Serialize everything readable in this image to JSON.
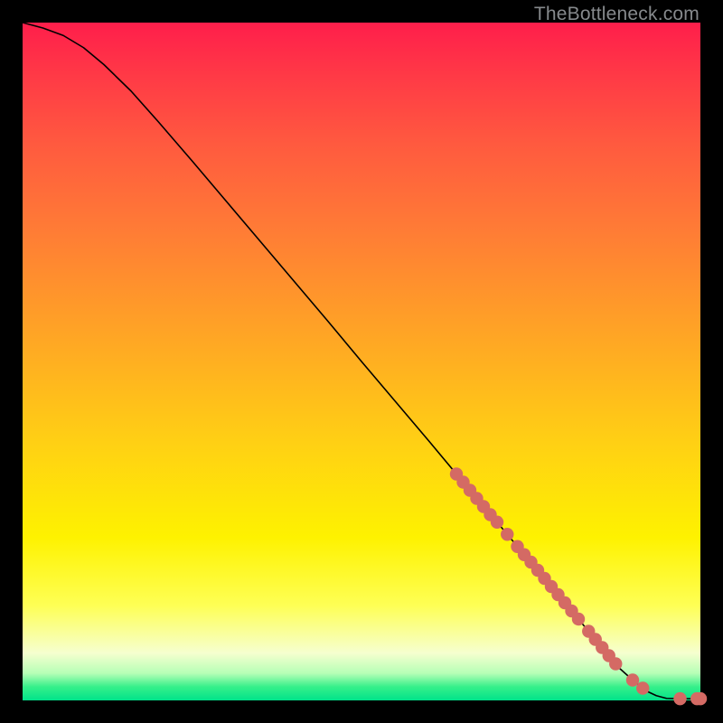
{
  "attribution": "TheBottleneck.com",
  "colors": {
    "background": "#000000",
    "gradient_top": "#ff1e4b",
    "gradient_mid": "#fef200",
    "gradient_bottom": "#00e28a",
    "curve": "#000000",
    "marker_fill": "#d46a64",
    "marker_stroke": "#b65550",
    "attribution_text": "#86898c"
  },
  "chart_data": {
    "type": "line",
    "title": "",
    "xlabel": "",
    "ylabel": "",
    "xlim": [
      0,
      100
    ],
    "ylim": [
      0,
      100
    ],
    "grid": false,
    "legend": false,
    "series": [
      {
        "name": "curve",
        "x": [
          0,
          3,
          6,
          9,
          12,
          16,
          20,
          25,
          30,
          35,
          40,
          45,
          50,
          55,
          60,
          65,
          70,
          72,
          75,
          78,
          80,
          82,
          84,
          86,
          88,
          90,
          92,
          93.5,
          95,
          97,
          100
        ],
        "y": [
          100,
          99.2,
          98.1,
          96.3,
          93.8,
          89.9,
          85.4,
          79.6,
          73.7,
          67.8,
          61.9,
          56.0,
          50.0,
          44.1,
          38.2,
          32.2,
          26.3,
          23.9,
          20.4,
          16.8,
          14.4,
          12.0,
          9.6,
          7.2,
          4.8,
          3.0,
          1.4,
          0.7,
          0.3,
          0.25,
          0.25
        ]
      }
    ],
    "markers": [
      {
        "x": 64.0,
        "y": 33.4,
        "r": 1.0
      },
      {
        "x": 65.0,
        "y": 32.2,
        "r": 1.0
      },
      {
        "x": 66.0,
        "y": 31.0,
        "r": 1.0
      },
      {
        "x": 67.0,
        "y": 29.8,
        "r": 1.0
      },
      {
        "x": 68.0,
        "y": 28.6,
        "r": 1.0
      },
      {
        "x": 69.0,
        "y": 27.4,
        "r": 1.0
      },
      {
        "x": 70.0,
        "y": 26.3,
        "r": 1.0
      },
      {
        "x": 71.5,
        "y": 24.5,
        "r": 1.0
      },
      {
        "x": 73.0,
        "y": 22.7,
        "r": 1.0
      },
      {
        "x": 74.0,
        "y": 21.5,
        "r": 1.0
      },
      {
        "x": 75.0,
        "y": 20.4,
        "r": 1.0
      },
      {
        "x": 76.0,
        "y": 19.2,
        "r": 1.0
      },
      {
        "x": 77.0,
        "y": 18.0,
        "r": 1.0
      },
      {
        "x": 78.0,
        "y": 16.8,
        "r": 1.0
      },
      {
        "x": 79.0,
        "y": 15.6,
        "r": 1.0
      },
      {
        "x": 80.0,
        "y": 14.4,
        "r": 1.0
      },
      {
        "x": 81.0,
        "y": 13.2,
        "r": 1.0
      },
      {
        "x": 82.0,
        "y": 12.0,
        "r": 1.0
      },
      {
        "x": 83.5,
        "y": 10.2,
        "r": 1.0
      },
      {
        "x": 84.5,
        "y": 9.0,
        "r": 1.0
      },
      {
        "x": 85.5,
        "y": 7.8,
        "r": 1.0
      },
      {
        "x": 86.5,
        "y": 6.6,
        "r": 1.0
      },
      {
        "x": 87.5,
        "y": 5.4,
        "r": 1.0
      },
      {
        "x": 90.0,
        "y": 3.0,
        "r": 1.0
      },
      {
        "x": 91.5,
        "y": 1.8,
        "r": 1.0
      },
      {
        "x": 97.0,
        "y": 0.25,
        "r": 1.0
      },
      {
        "x": 99.5,
        "y": 0.25,
        "r": 1.0
      },
      {
        "x": 100.0,
        "y": 0.25,
        "r": 1.0
      }
    ]
  }
}
